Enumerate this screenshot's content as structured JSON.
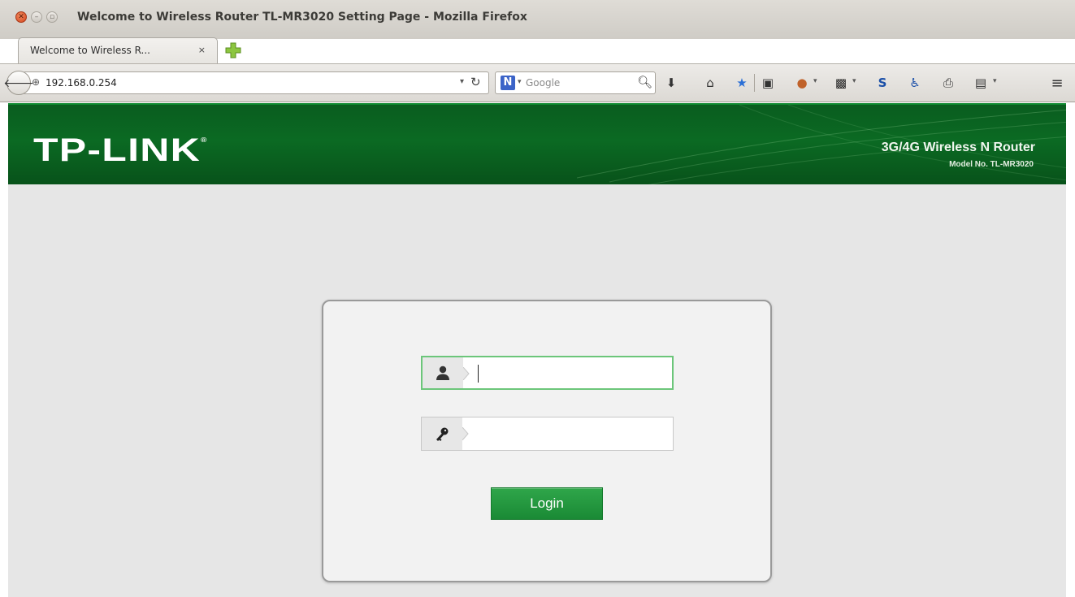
{
  "window": {
    "title": "Welcome to Wireless Router TL-MR3020 Setting Page - Mozilla Firefox"
  },
  "tab": {
    "label": "Welcome to Wireless R...",
    "close_glyph": "×"
  },
  "navbar": {
    "url": "192.168.0.254",
    "search_engine_glyph": "N",
    "search_placeholder": "Google"
  },
  "page": {
    "logo": "TP-LINK",
    "logo_mark": "®",
    "product": "3G/4G Wireless N Router",
    "model": "Model No. TL-MR3020",
    "username_value": "",
    "password_value": "",
    "login_label": "Login"
  },
  "colors": {
    "header_green": "#0b6a23",
    "login_green": "#1f9a3e",
    "focus_green": "#6cc67a"
  }
}
